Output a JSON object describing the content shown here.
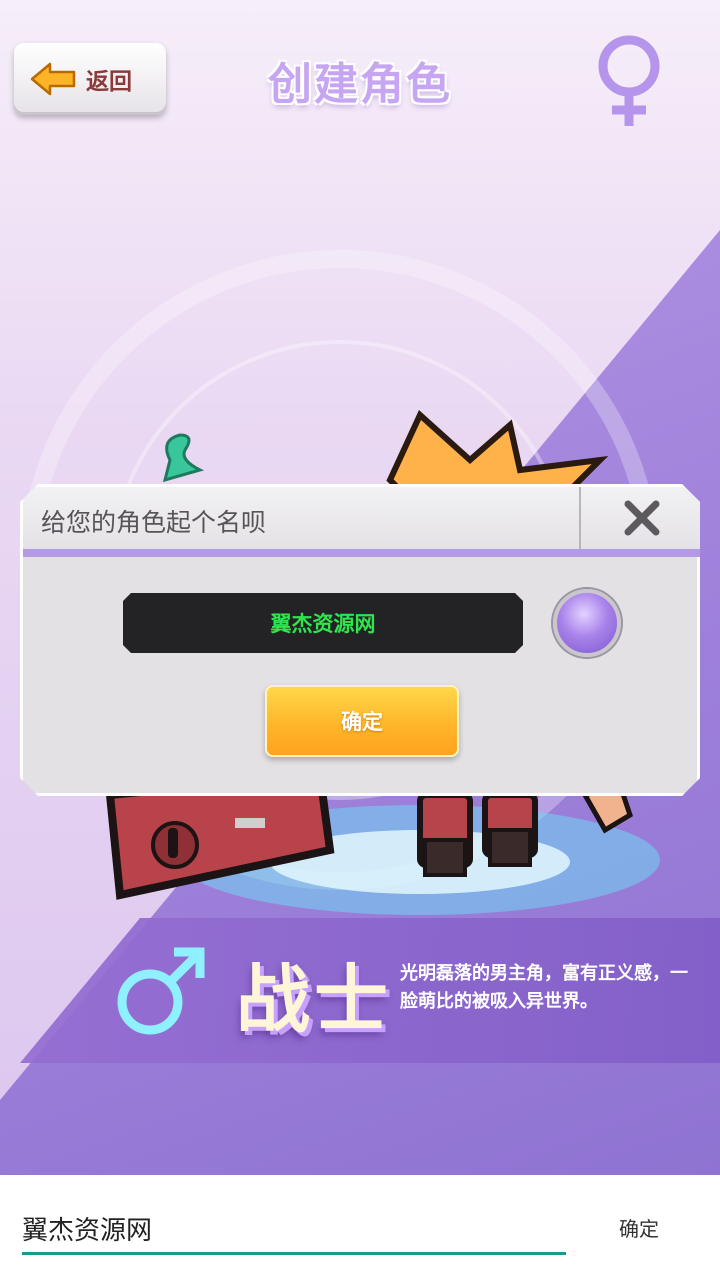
{
  "header": {
    "back_label": "返回",
    "title": "创建角色",
    "gender_icon": "female-symbol"
  },
  "character_class": {
    "name": "战士",
    "description": "光明磊落的男主角，富有正义感，一脸萌比的被吸入异世界。",
    "gender_icon": "male-symbol"
  },
  "name_dialog": {
    "title": "给您的角色起个名呗",
    "name_value": "翼杰资源网",
    "confirm_label": "确定",
    "close_icon": "close-x"
  },
  "input_bar": {
    "value": "翼杰资源网",
    "confirm_label": "确定"
  },
  "colors": {
    "accent_purple": "#b49ae4",
    "name_text": "#2fe44c",
    "confirm_orange": "#ffb62a",
    "input_underline": "#1a9a8a"
  }
}
